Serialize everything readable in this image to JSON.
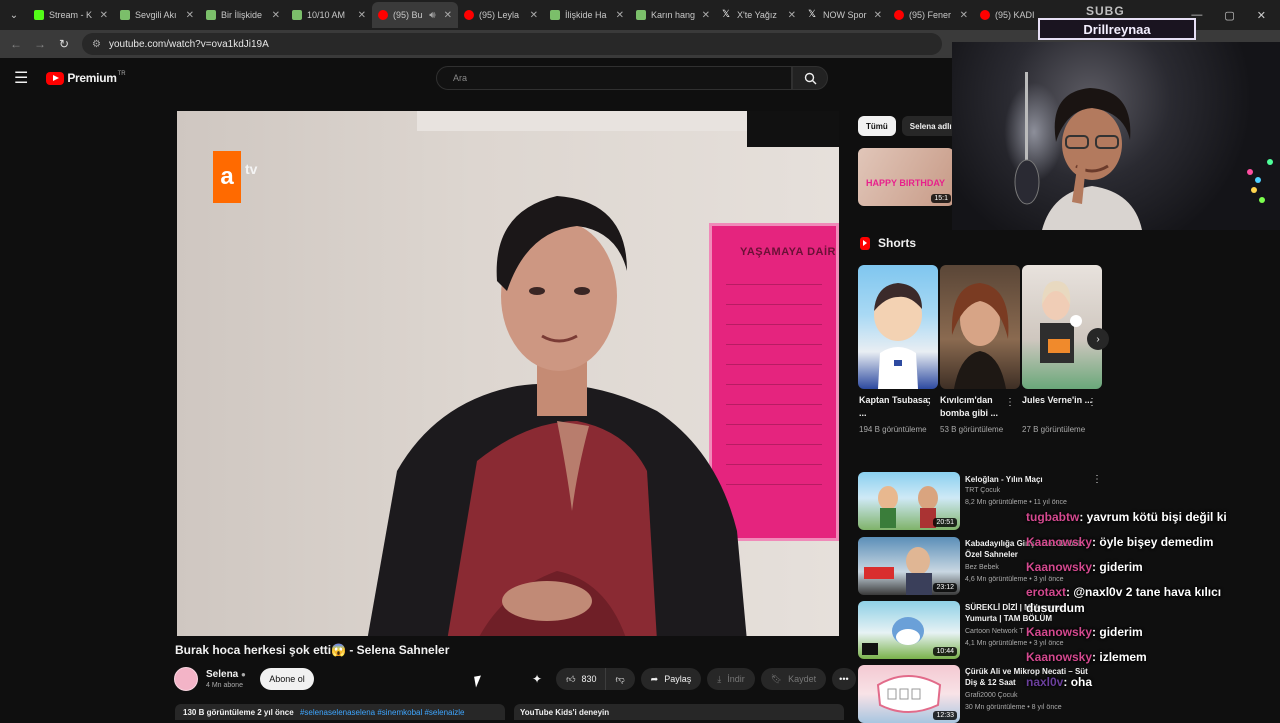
{
  "browser": {
    "tabs": [
      {
        "label": "Stream - K",
        "color": "#53fc18"
      },
      {
        "label": "Sevgili Akı",
        "color": "#7bbf6a"
      },
      {
        "label": "Bir İlişkide",
        "color": "#7bbf6a"
      },
      {
        "label": "10/10 AM",
        "color": "#7bbf6a"
      },
      {
        "label": "(95) Bu",
        "color": "#ff0000",
        "active": true
      },
      {
        "label": "(95) Leyla",
        "color": "#ff0000"
      },
      {
        "label": "İlişkide Ha",
        "color": "#7bbf6a"
      },
      {
        "label": "Karın hang",
        "color": "#7bbf6a"
      },
      {
        "label": "X'te Yağız",
        "color": "#ffffff"
      },
      {
        "label": "NOW Spor",
        "color": "#ffffff"
      },
      {
        "label": "(95) Fener",
        "color": "#ff0000"
      },
      {
        "label": "(95) KADI",
        "color": "#ff0000"
      }
    ],
    "url": "youtube.com/watch?v=ova1kdJi19A"
  },
  "youtube": {
    "logo_text": "Premium",
    "logo_region": "TR",
    "search_placeholder": "Ara",
    "video": {
      "title": "Burak hoca herkesi şok etti😱 - Selena Sahneler",
      "channel": "Selena",
      "subscribers": "4 Mn abone",
      "subscribe_label": "Abone ol",
      "likes": "830",
      "share_label": "Paylaş",
      "download_label": "İndir",
      "save_label": "Kaydet",
      "views_age": "130 B görüntüleme  2 yıl önce",
      "hashtags": "#selenaselenaselena #sinemkobal #selenaizle",
      "kids_promo": "YouTube Kids'i deneyin",
      "poster_text": "YAŞAMAYA DAİR"
    },
    "chips": [
      {
        "label": "Tümü",
        "active": true
      },
      {
        "label": "Selena adlı y",
        "active": false
      }
    ],
    "top_rec": {
      "label": "HAPPY BIRTHDAY",
      "duration": "15:1"
    },
    "shorts_label": "Shorts",
    "shorts": [
      {
        "title": "Kaptan Tsubasa; ...",
        "views": "194 B görüntüleme"
      },
      {
        "title": "Kıvılcım'dan bomba gibi ...",
        "views": "53 B görüntüleme"
      },
      {
        "title": "Jules Verne'in ...",
        "views": "27 B görüntüleme"
      }
    ],
    "recommendations": [
      {
        "title": "Keloğlan - Yılın Maçı",
        "channel": "TRT Çocuk",
        "meta": "8,2 Mn görüntüleme • 11 yıl önce",
        "duration": "20:51"
      },
      {
        "title": "Kabadayılığa Giriş - Bez Bebek Özel Sahneler",
        "channel": "Bez Bebek",
        "meta": "4,6 Mn görüntüleme • 3 yıl önce",
        "duration": "23:12"
      },
      {
        "title": "SÜREKLİ DİZİ | Mükemmel Yumurta | TAM BÖLÜM",
        "channel": "Cartoon Network T",
        "meta": "4,1 Mn görüntüleme • 3 yıl önce",
        "duration": "10:44"
      },
      {
        "title": "Çürük Ali ve Mikrop Necati – Süt Diş & 12 Saat",
        "channel": "Grafi2000 Çocuk",
        "meta": "30 Mn görüntüleme • 8 yıl önce",
        "duration": "12:33"
      }
    ]
  },
  "stream": {
    "sub_label": "SUBG",
    "streamer_name": "Drillreynaa",
    "chat": [
      {
        "user": "tugbabtw",
        "text": ": yavrum kötü bişi değil ki"
      },
      {
        "user": "Kaanowsky",
        "text": ": öyle bişey demedim"
      },
      {
        "user": "Kaanowsky",
        "text": ": giderim"
      },
      {
        "user": "erotaxt",
        "text": ": @naxl0v 2 tane hava kılıcı dusurdum"
      },
      {
        "user": "Kaanowsky",
        "text": ": giderim"
      },
      {
        "user": "Kaanowsky",
        "text": ": izlemem"
      },
      {
        "user": "naxl0v",
        "text": ": oha"
      }
    ]
  }
}
